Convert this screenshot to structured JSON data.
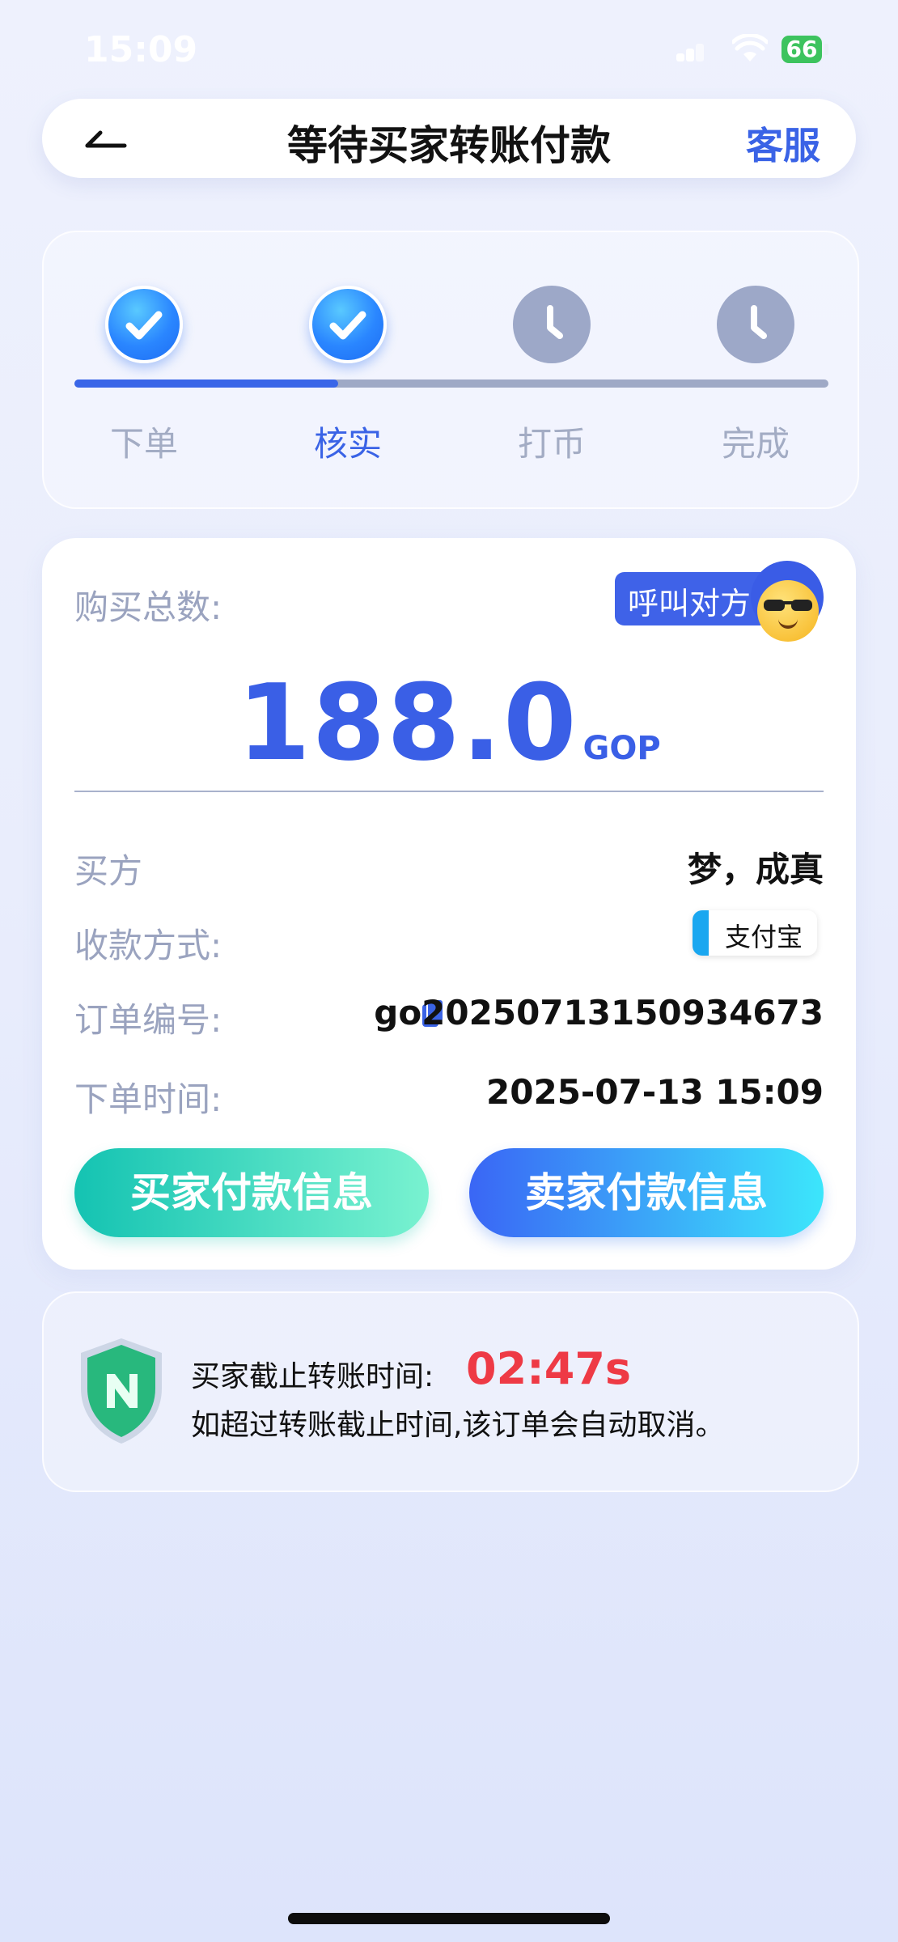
{
  "status": {
    "time": "15:09",
    "battery": "66"
  },
  "header": {
    "title": "等待买家转账付款",
    "service": "客服"
  },
  "progress": {
    "steps": [
      {
        "label": "下单",
        "state": "done"
      },
      {
        "label": "核实",
        "state": "done"
      },
      {
        "label": "打币",
        "state": "pending"
      },
      {
        "label": "完成",
        "state": "pending"
      }
    ],
    "completed_fraction": 0.35
  },
  "order": {
    "total_label": "购买总数:",
    "call_label": "呼叫对方",
    "amount": "188.0",
    "unit": "GOP",
    "buyer_label": "买方",
    "buyer_value": "梦，成真",
    "pay_method_label": "收款方式:",
    "pay_method_value": "支付宝",
    "order_no_label": "订单编号:",
    "order_no_value": "go20250713150934673",
    "order_time_label": "下单时间:",
    "order_time_value": "2025-07-13 15:09",
    "buyer_pay_button": "买家付款信息",
    "seller_pay_button": "卖家付款信息"
  },
  "countdown": {
    "label": "买家截止转账时间:",
    "time": "02:47s",
    "note": "如超过转账截止时间,该订单会自动取消。"
  },
  "colors": {
    "accent": "#3a63e6",
    "danger": "#ee3a45",
    "done": "#2a86ff",
    "pending": "#9da8c8"
  }
}
